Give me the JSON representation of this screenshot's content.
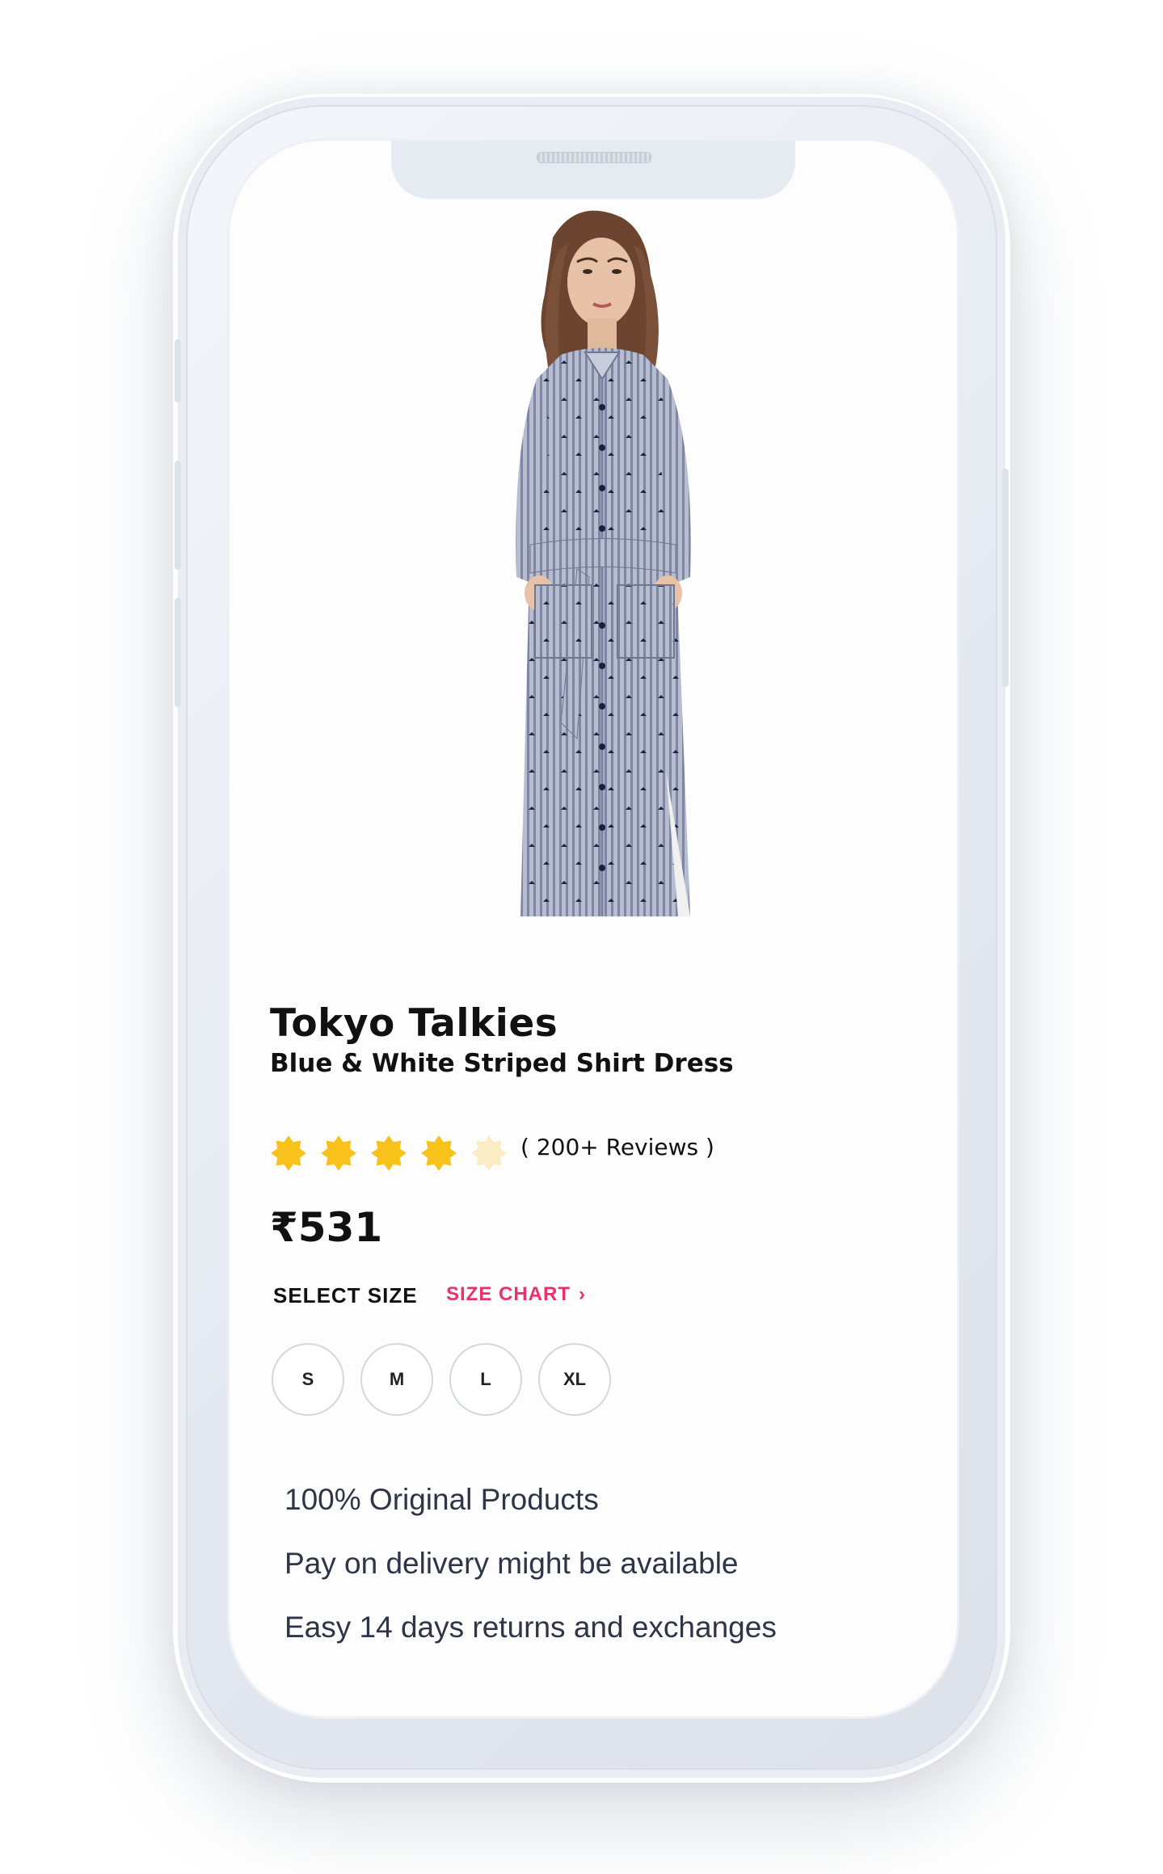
{
  "product": {
    "brand": "Tokyo Talkies",
    "name": "Blue & White Striped Shirt Dress",
    "rating": 4,
    "rating_max": 5,
    "reviews_label": "( 200+ Reviews )",
    "price": "₹531",
    "image_icon": "dress-product-image"
  },
  "size_section": {
    "select_label": "SELECT SIZE",
    "chart_label": "SIZE CHART",
    "sizes": [
      "S",
      "M",
      "L",
      "XL"
    ]
  },
  "features": [
    "100% Original Products",
    "Pay on delivery might be available",
    "Easy 14 days returns and exchanges"
  ],
  "colors": {
    "accent": "#e8336a",
    "star": "#f8c21b",
    "star_empty": "#fbecc4",
    "text": "#111111",
    "feature_text": "#2e3547"
  }
}
